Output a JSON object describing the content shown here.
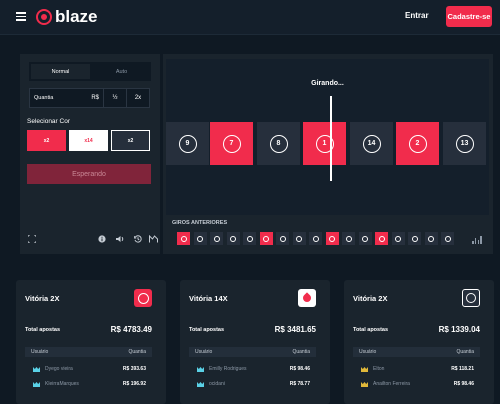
{
  "header": {
    "logo_text": "blaze",
    "login_label": "Entrar",
    "signup_label": "Cadastre-se"
  },
  "bet_panel": {
    "tabs": [
      {
        "label": "Normal",
        "active": true
      },
      {
        "label": "Auto",
        "active": false
      }
    ],
    "amount_label": "Quantia",
    "currency": "R$",
    "half_label": "½",
    "double_label": "2x",
    "select_color_label": "Selecionar Cor",
    "colors": [
      {
        "label": "x2",
        "color": "red"
      },
      {
        "label": "x14",
        "color": "white"
      },
      {
        "label": "x2",
        "color": "black"
      }
    ],
    "submit_label": "Esperando",
    "tools": [
      "fullscreen-icon",
      "info-icon",
      "volume-icon",
      "history-icon",
      "stats-icon"
    ]
  },
  "roulette": {
    "status": "Girando...",
    "tiles": [
      {
        "n": "9",
        "color": "black"
      },
      {
        "n": "7",
        "color": "red"
      },
      {
        "n": "8",
        "color": "black"
      },
      {
        "n": "1",
        "color": "red"
      },
      {
        "n": "14",
        "color": "black"
      },
      {
        "n": "2",
        "color": "red"
      },
      {
        "n": "13",
        "color": "black"
      }
    ],
    "history_label": "GIROS ANTERIORES",
    "history": [
      "red",
      "black",
      "black",
      "black",
      "black",
      "red",
      "black",
      "black",
      "black",
      "red",
      "black",
      "black",
      "red",
      "black",
      "black",
      "black",
      "black"
    ]
  },
  "cards": [
    {
      "title": "Vitória 2X",
      "icon": "red",
      "total_label": "Total apostas",
      "total": "R$ 4783.49",
      "col_user": "Usuário",
      "col_amount": "Quantia",
      "rows": [
        {
          "user": "Dyego vieira",
          "amount": "R$ 393.63",
          "crown": "cyan"
        },
        {
          "user": "KleirraMarques",
          "amount": "R$ 196.92",
          "crown": "cyan"
        }
      ]
    },
    {
      "title": "Vitória 14X",
      "icon": "white",
      "total_label": "Total apostas",
      "total": "R$ 3481.65",
      "col_user": "Usuário",
      "col_amount": "Quantia",
      "rows": [
        {
          "user": "Emilly Rodrigues",
          "amount": "R$ 98.46",
          "crown": "cyan"
        },
        {
          "user": "ocidani",
          "amount": "R$ 78.77",
          "crown": "cyan"
        }
      ]
    },
    {
      "title": "Vitória 2X",
      "icon": "black",
      "total_label": "Total apostas",
      "total": "R$ 1339.04",
      "col_user": "Usuário",
      "col_amount": "Quantia",
      "rows": [
        {
          "user": "Elton",
          "amount": "R$ 118.21",
          "crown": "gold"
        },
        {
          "user": "Anailton Ferreira",
          "amount": "R$ 98.46",
          "crown": "gold"
        }
      ]
    }
  ],
  "colors": {
    "accent": "#f12c4c",
    "bg": "#0f1923",
    "panel": "#1a242d",
    "black_tile": "#262f3c"
  }
}
